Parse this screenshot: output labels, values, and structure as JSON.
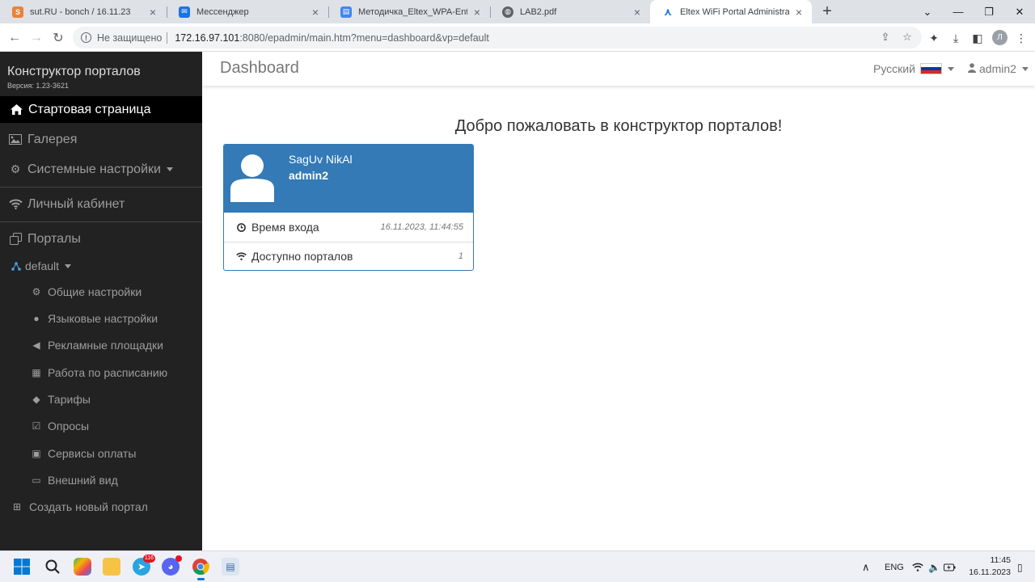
{
  "browser": {
    "tabs": [
      {
        "title": "sut.RU - bonch / 16.11.23",
        "favicon": "sut-icon",
        "favicon_color": "#e8833a",
        "active": false
      },
      {
        "title": "Мессенджер",
        "favicon": "messenger-icon",
        "favicon_color": "#1a73e8",
        "active": false
      },
      {
        "title": "Методичка_Eltex_WPA-Enterprise",
        "favicon": "docs-icon",
        "favicon_color": "#4285f4",
        "active": false
      },
      {
        "title": "LAB2.pdf",
        "favicon": "globe-icon",
        "favicon_color": "#5f6368",
        "active": false
      },
      {
        "title": "Eltex WiFi Portal Administrator c",
        "favicon": "eltex-icon",
        "favicon_color": "#1a73e8",
        "active": true
      }
    ],
    "address": {
      "security_label": "Не защищено",
      "host": "172.16.97.101",
      "path": ":8080/epadmin/main.htm?menu=dashboard&vp=default"
    },
    "profile_initial": "Л"
  },
  "sidebar": {
    "brand": "Конструктор порталов",
    "version": "Версия: 1.23-3621",
    "items": [
      {
        "label": "Стартовая страница",
        "icon": "home-icon",
        "active": true
      },
      {
        "label": "Галерея",
        "icon": "image-icon",
        "active": false
      },
      {
        "label": "Системные настройки",
        "icon": "cogs-icon",
        "active": false
      },
      {
        "label": "Личный кабинет",
        "icon": "wifi-icon",
        "active": false
      },
      {
        "label": "Порталы",
        "icon": "clone-icon",
        "active": false
      }
    ],
    "portal": {
      "label": "default",
      "icon": "sitemap-icon"
    },
    "portal_items": [
      {
        "label": "Общие настройки",
        "icon": "gear-icon"
      },
      {
        "label": "Языковые настройки",
        "icon": "globe-icon"
      },
      {
        "label": "Рекламные площадки",
        "icon": "bullhorn-icon"
      },
      {
        "label": "Работа по расписанию",
        "icon": "calendar-icon"
      },
      {
        "label": "Тарифы",
        "icon": "tags-icon"
      },
      {
        "label": "Опросы",
        "icon": "check-square-icon"
      },
      {
        "label": "Сервисы оплаты",
        "icon": "money-icon"
      },
      {
        "label": "Внешний вид",
        "icon": "desktop-icon"
      }
    ],
    "create_portal": "Создать новый портал"
  },
  "header": {
    "title": "Dashboard",
    "language": "Русский",
    "user": "admin2"
  },
  "main": {
    "welcome": "Добро пожаловать в конструктор порталов!",
    "card": {
      "name": "SagUv NikAl",
      "login": "admin2",
      "rows": [
        {
          "label": "Время входа",
          "value": "16.11.2023, 11:44:55",
          "icon": "clock-icon"
        },
        {
          "label": "Доступно порталов",
          "value": "1",
          "icon": "wifi-icon"
        }
      ]
    }
  },
  "taskbar": {
    "language": "ENG",
    "time": "11:45",
    "date": "16.11.2023",
    "telegram_badge": "116"
  },
  "colors": {
    "sidebar_bg": "#222222",
    "active_bg": "#000000",
    "primary": "#337ab7"
  }
}
